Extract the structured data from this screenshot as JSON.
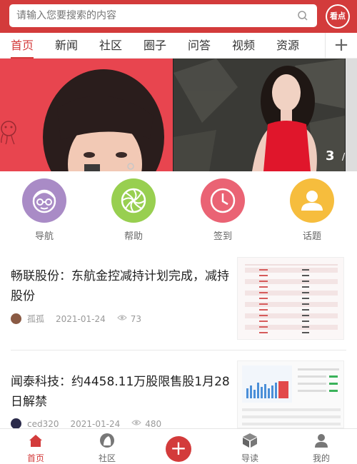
{
  "header": {
    "search_placeholder": "请输入您要搜索的内容",
    "logo_text": "看点"
  },
  "tabs": [
    {
      "label": "首页",
      "active": true
    },
    {
      "label": "新闻"
    },
    {
      "label": "社区"
    },
    {
      "label": "圈子"
    },
    {
      "label": "问答"
    },
    {
      "label": "视频"
    },
    {
      "label": "资源"
    }
  ],
  "tab_add_label": "+",
  "banner": {
    "pagination_current": "3",
    "pagination_sep": "/"
  },
  "quick_nav": [
    {
      "label": "导航",
      "color": "#a98bc6",
      "icon": "face-glasses-icon"
    },
    {
      "label": "帮助",
      "color": "#98cf50",
      "icon": "aperture-icon"
    },
    {
      "label": "签到",
      "color": "#ea6374",
      "icon": "clock-icon"
    },
    {
      "label": "话题",
      "color": "#f6bd3d",
      "icon": "user-icon"
    }
  ],
  "news": [
    {
      "title": "畅联股份：东航金控减持计划完成，减持股份",
      "author": "孤孤",
      "date": "2021-01-24",
      "views": "73"
    },
    {
      "title": "闻泰科技：约4458.11万股限售股1月28日解禁",
      "author": "ced320",
      "date": "2021-01-24",
      "views": "480"
    }
  ],
  "bottom_nav": [
    {
      "label": "首页",
      "icon": "home-icon",
      "active": true
    },
    {
      "label": "社区",
      "icon": "community-icon"
    },
    {
      "label": "+",
      "icon": "plus-icon"
    },
    {
      "label": "导读",
      "icon": "box-icon"
    },
    {
      "label": "我的",
      "icon": "profile-icon"
    }
  ],
  "colors": {
    "brand": "#d33b3b"
  }
}
